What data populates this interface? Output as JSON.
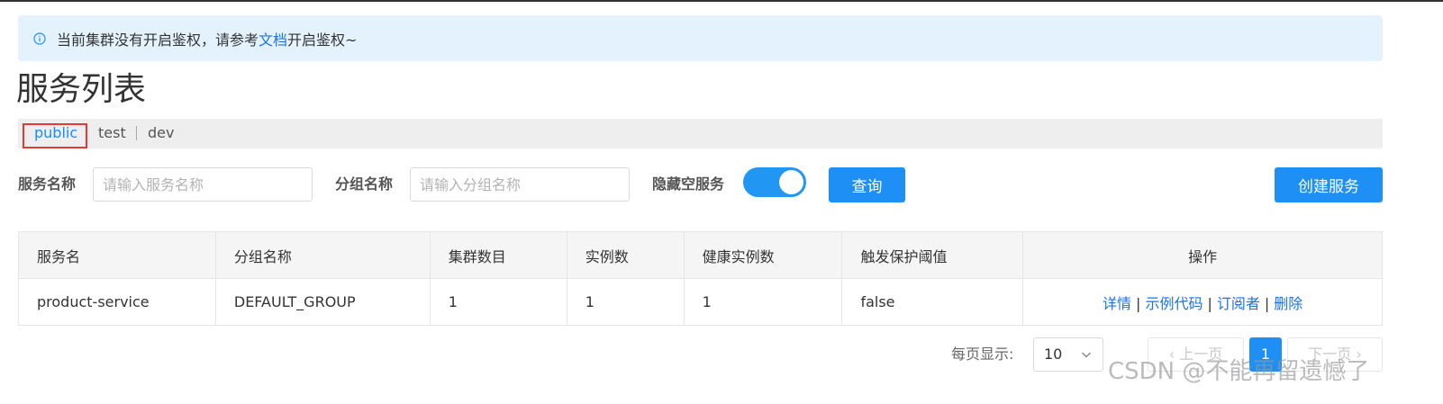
{
  "notice": {
    "text_before": "当前集群没有开启鉴权，请参考",
    "link_text": "文档",
    "text_after": "开启鉴权~"
  },
  "page": {
    "title": "服务列表"
  },
  "namespaces": {
    "items": [
      "public",
      "test",
      "dev"
    ],
    "active": "public"
  },
  "filters": {
    "service_name_label": "服务名称",
    "service_name_placeholder": "请输入服务名称",
    "group_name_label": "分组名称",
    "group_name_placeholder": "请输入分组名称",
    "hide_empty_label": "隐藏空服务",
    "hide_empty_on": true,
    "query_button": "查询",
    "create_button": "创建服务"
  },
  "table": {
    "headers": [
      "服务名",
      "分组名称",
      "集群数目",
      "实例数",
      "健康实例数",
      "触发保护阈值",
      "操作"
    ],
    "rows": [
      {
        "service_name": "product-service",
        "group_name": "DEFAULT_GROUP",
        "cluster_count": "1",
        "instance_count": "1",
        "healthy_instance_count": "1",
        "protect_threshold": "false",
        "actions": [
          "详情",
          "示例代码",
          "订阅者",
          "删除"
        ],
        "action_separator": "|"
      }
    ]
  },
  "pagination": {
    "page_size_label": "每页显示:",
    "page_size": "10",
    "prev_label": "上一页",
    "current_page": "1",
    "next_label": "下一页"
  },
  "watermark": "CSDN @不能再留遗憾了",
  "colors": {
    "primary": "#1e90f5",
    "link": "#1a73e8",
    "notice_bg": "#e4f2fd",
    "highlight_border": "#e53935"
  }
}
